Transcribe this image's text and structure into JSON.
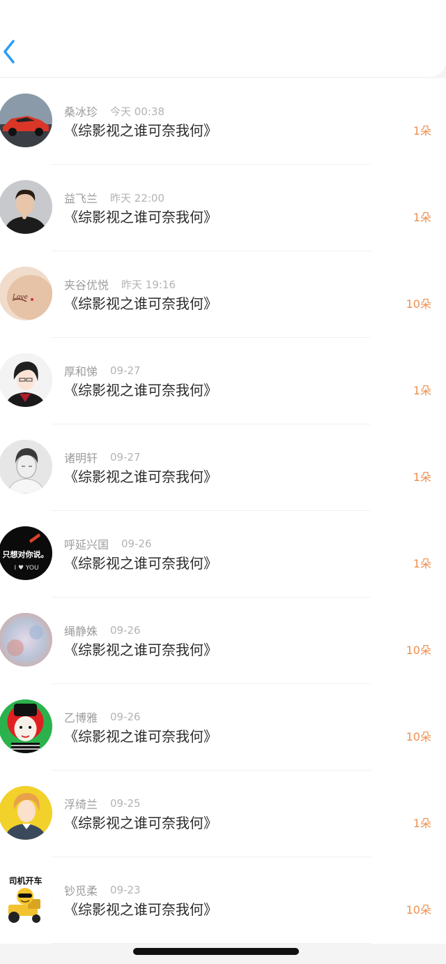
{
  "header": {
    "back_icon": "chevron-left-icon",
    "accent": "#2a9df4"
  },
  "colors": {
    "count": "#ef8f4e",
    "name": "#9c9c9c",
    "title": "#2a2a2a"
  },
  "items": [
    {
      "name": "桑冰珍",
      "time": "今天 00:38",
      "title": "《综影视之谁可奈我何》",
      "count": "1朵",
      "avatar": "red-sports-car"
    },
    {
      "name": "益飞兰",
      "time": "昨天 22:00",
      "title": "《综影视之谁可奈我何》",
      "count": "1朵",
      "avatar": "young-man-portrait"
    },
    {
      "name": "夹谷优悦",
      "time": "昨天 19:16",
      "title": "《综影视之谁可奈我何》",
      "count": "10朵",
      "avatar": "shoulder-tattoo"
    },
    {
      "name": "厚和悌",
      "time": "09-27",
      "title": "《综影视之谁可奈我何》",
      "count": "1朵",
      "avatar": "anime-boy"
    },
    {
      "name": "诸明轩",
      "time": "09-27",
      "title": "《综影视之谁可奈我何》",
      "count": "1朵",
      "avatar": "sketch-portrait"
    },
    {
      "name": "呼延兴国",
      "time": "09-26",
      "title": "《综影视之谁可奈我何》",
      "count": "1朵",
      "avatar": "black-text-card",
      "avatar_text": "只想对你说。",
      "avatar_sub": "I ♥ YOU"
    },
    {
      "name": "绳静姝",
      "time": "09-26",
      "title": "《综影视之谁可奈我何》",
      "count": "10朵",
      "avatar": "blurred-pastel"
    },
    {
      "name": "乙博雅",
      "time": "09-26",
      "title": "《综影视之谁可奈我何》",
      "count": "10朵",
      "avatar": "cartoon-red-green"
    },
    {
      "name": "浮绮兰",
      "time": "09-25",
      "title": "《综影视之谁可奈我何》",
      "count": "1朵",
      "avatar": "anime-yellow"
    },
    {
      "name": "钞觅柔",
      "time": "09-23",
      "title": "《综影视之谁可奈我何》",
      "count": "10朵",
      "avatar": "tractor-emoji",
      "avatar_text": "司机开车"
    }
  ]
}
